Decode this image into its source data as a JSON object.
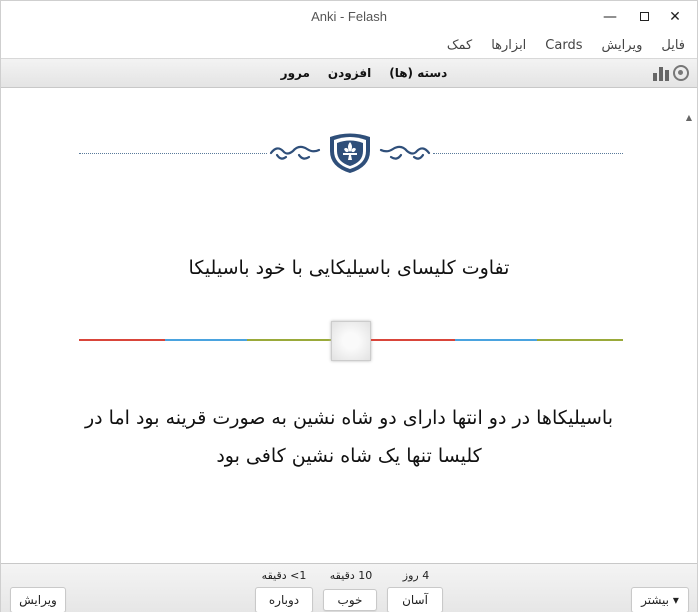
{
  "window": {
    "title": "Anki - Felash"
  },
  "menu": {
    "items": [
      "فایل",
      "ویرایش",
      "Cards",
      "ابزارها",
      "کمک"
    ]
  },
  "toolbar": {
    "decks_label": "دسته (ها)",
    "add_label": "افزودن",
    "browse_label": "مرور"
  },
  "card": {
    "question": "تفاوت کلیسای باسیلیکایی با خود باسیلیکا",
    "answer_line1": "باسیلیکاها در دو انتها دارای دو شاه نشین به صورت قرینه بود اما در",
    "answer_line2": "کلیسا تنها یک شاه نشین کافی بود",
    "divider_colors": [
      "#d9453a",
      "#4aa3df",
      "#9aaa3a"
    ],
    "ornament_color": "#2f4f7a"
  },
  "bottom": {
    "edit_label": "ویرایش",
    "more_label": "بیشتر ▾",
    "again_label": "دوباره",
    "good_label": "خوب",
    "easy_label": "آسان",
    "again_interval": "1> دقیقه",
    "good_interval": "10 دقیقه",
    "easy_interval": "4 روز"
  }
}
